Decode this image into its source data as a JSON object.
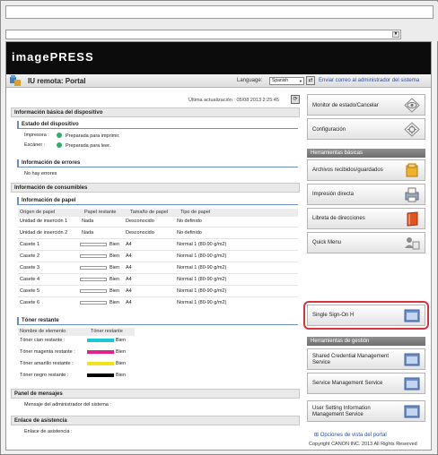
{
  "app": {
    "brand": "imagePRESS",
    "portal_title": "IU remota: Portal",
    "language_label": "Language:",
    "language_value": "Spanish",
    "mail_link": "Enviar correo al administrador del sistema",
    "last_update": "Última actualización : 05/08 2013 2:25:45",
    "copyright": "Copyright CANON INC. 2013 All Rights Reserved"
  },
  "sections": {
    "basic_info": "Información básica del dispositivo",
    "device_status": "Estado del dispositivo",
    "printer_label": "Impresora :",
    "printer_status": "Preparada para imprimir.",
    "scanner_label": "Escáner :",
    "scanner_status": "Preparada para leer.",
    "errors": "Información de errores",
    "no_errors": "No hay errores",
    "consumables": "Información de consumibles",
    "paper_info": "Información de papel",
    "toner": "Tóner restante",
    "messages": "Panel de mensajes",
    "admin_message": "Mensaje del administrador del sistema :",
    "assist": "Enlace de asistencia",
    "assist_link": "Enlace de asistencia :"
  },
  "paper_table": {
    "headers": [
      "Origen de papel",
      "Papel restante",
      "Tamaño de papel",
      "Tipo de papel"
    ],
    "rows": [
      {
        "source": "Unidad de inserción 1",
        "remaining": "Nada",
        "size": "Desconocido",
        "type": "No definido"
      },
      {
        "source": "Unidad de inserción 2",
        "remaining": "Nada",
        "size": "Desconocido",
        "type": "No definido"
      },
      {
        "source": "Casete 1",
        "remaining": "Bien",
        "size": "A4",
        "type": "Normal 1 (80-90 g/m2)"
      },
      {
        "source": "Casete 2",
        "remaining": "Bien",
        "size": "A4",
        "type": "Normal 1 (80-90 g/m2)"
      },
      {
        "source": "Casete 3",
        "remaining": "Bien",
        "size": "A4",
        "type": "Normal 1 (80-90 g/m2)"
      },
      {
        "source": "Casete 4",
        "remaining": "Bien",
        "size": "A4",
        "type": "Normal 1 (80-90 g/m2)"
      },
      {
        "source": "Casete 5",
        "remaining": "Bien",
        "size": "A4",
        "type": "Normal 1 (80-90 g/m2)"
      },
      {
        "source": "Casete 6",
        "remaining": "Bien",
        "size": "A4",
        "type": "Normal 1 (80-90 g/m2)"
      }
    ]
  },
  "toner_table": {
    "headers": [
      "Nombre de elemento",
      "Tóner restante"
    ],
    "rows": [
      {
        "name": "Tóner cian restante :",
        "status": "Bien",
        "color": "#19c8d8"
      },
      {
        "name": "Tóner magenta restante :",
        "status": "Bien",
        "color": "#e2238a"
      },
      {
        "name": "Tóner amarillo restante :",
        "status": "Bien",
        "color": "#f2e21a"
      },
      {
        "name": "Tóner negro restante :",
        "status": "Bien",
        "color": "#000000"
      }
    ]
  },
  "right_menu": {
    "status_monitor": "Monitor de estado/Cancelar",
    "settings": "Configuración",
    "basic_tools_header": "Herramientas básicas",
    "received_files": "Archivos recibidos/guardados",
    "direct_print": "Impresión directa",
    "address_book": "Libreta de direcciones",
    "quick_menu": "Quick Menu",
    "single_sign_on": "Single Sign-On H",
    "mgmt_tools_header": "Herramientas de gestión",
    "shared_credential": "Shared Credential Management Service",
    "service_mgmt": "Service Management Service",
    "user_setting": "User Setting Information Management Service",
    "view_options": "Opciones de vista del portal"
  },
  "colors": {
    "accent_link": "#2b4f9e",
    "highlight_ring": "#d9323b",
    "status_ok": "#28b36a"
  }
}
